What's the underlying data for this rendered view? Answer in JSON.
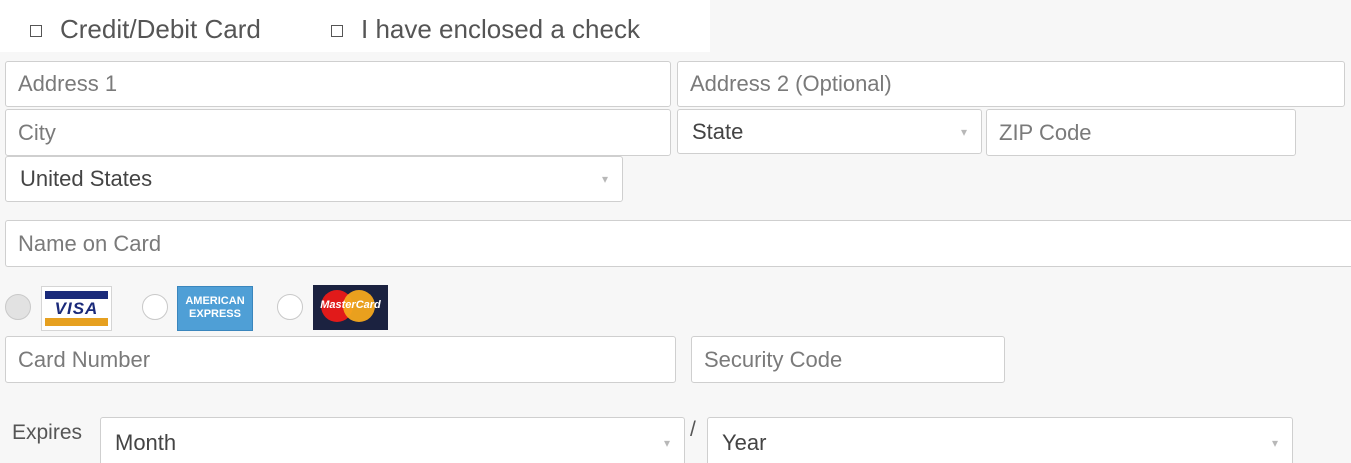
{
  "payment_methods": {
    "credit_card": "Credit/Debit Card",
    "check": "I have enclosed a check"
  },
  "address": {
    "address1_placeholder": "Address 1",
    "address2_placeholder": "Address 2 (Optional)",
    "city_placeholder": "City",
    "state_value": "State",
    "zip_placeholder": "ZIP Code",
    "country_value": "United States"
  },
  "card": {
    "name_placeholder": "Name on Card",
    "logos": {
      "visa": "VISA",
      "amex_line1": "AMERICAN",
      "amex_line2": "EXPRESS",
      "mastercard": "MasterCard"
    },
    "number_placeholder": "Card Number",
    "security_placeholder": "Security Code",
    "expires_label": "Expires",
    "month_value": "Month",
    "separator": "/",
    "year_value": "Year"
  },
  "icons": {
    "checkbox": "square-outline",
    "select_caret": "caret-down-icon"
  }
}
